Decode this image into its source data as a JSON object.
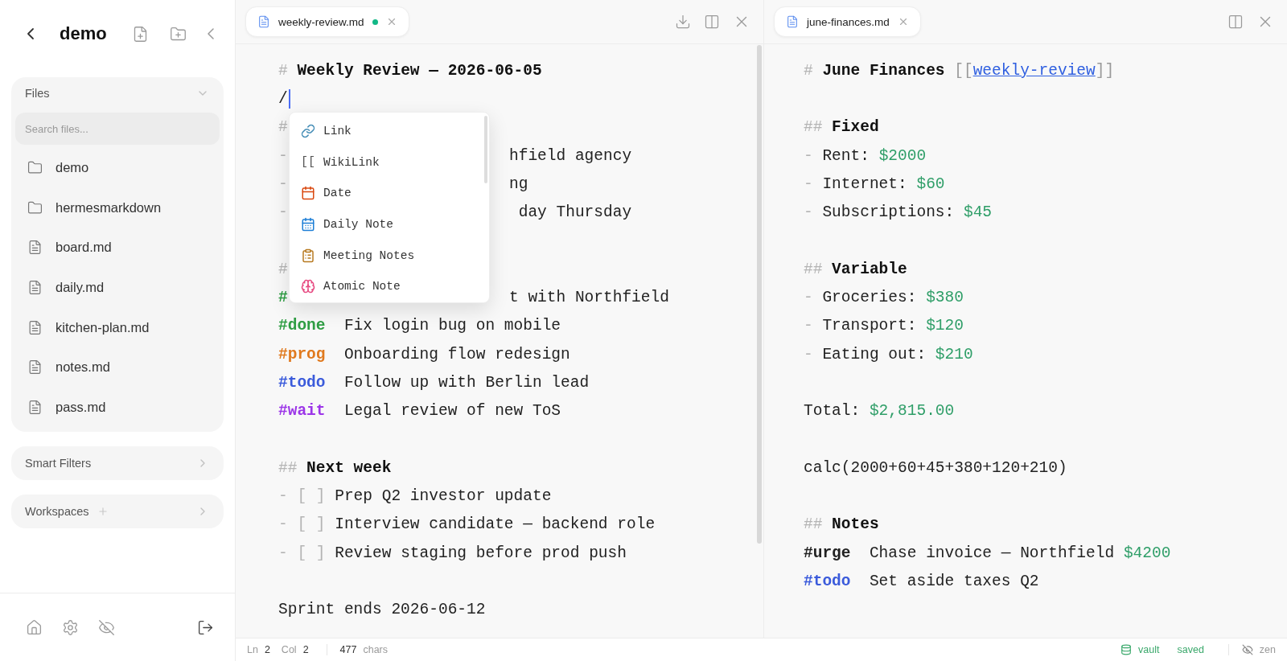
{
  "sidebar": {
    "title": "demo",
    "files": {
      "title": "Files",
      "expanded": true,
      "search": {
        "placeholder": "Search files..."
      },
      "items": [
        {
          "kind": "folder",
          "name": "demo"
        },
        {
          "kind": "folder",
          "name": "hermesmarkdown"
        },
        {
          "kind": "file",
          "name": "board.md"
        },
        {
          "kind": "file",
          "name": "daily.md"
        },
        {
          "kind": "file",
          "name": "kitchen-plan.md"
        },
        {
          "kind": "file",
          "name": "notes.md"
        },
        {
          "kind": "file",
          "name": "pass.md"
        }
      ]
    },
    "sections": [
      {
        "title": "Smart Filters",
        "addable": false
      },
      {
        "title": "Workspaces",
        "addable": true
      }
    ]
  },
  "panes": [
    {
      "tab": {
        "label": "weekly-review.md",
        "modified": true
      },
      "actions": [
        {
          "kind": "download"
        },
        {
          "kind": "split"
        },
        {
          "kind": "close"
        }
      ],
      "scrollbar": true,
      "lines": [
        {
          "kind": "text",
          "segments": [
            {
              "kind": "mark",
              "text": "#"
            },
            {
              "kind": "heading",
              "text": "Weekly Review — 2026-06-05"
            }
          ]
        },
        {
          "kind": "text",
          "cursor": true,
          "segments": [
            {
              "kind": "text",
              "text": "/"
            }
          ]
        },
        {
          "kind": "split",
          "left": {
            "kind": "mark",
            "text": "#"
          }
        },
        {
          "kind": "split",
          "left": {
            "kind": "mark",
            "text": "-"
          },
          "right": "hfield agency"
        },
        {
          "kind": "split",
          "left": {
            "kind": "mark",
            "text": "-"
          },
          "right": "ng"
        },
        {
          "kind": "split",
          "left": {
            "kind": "mark",
            "text": "-"
          },
          "right": " day Thursday"
        },
        {
          "kind": "blank"
        },
        {
          "kind": "split",
          "left": {
            "kind": "mark",
            "text": "#"
          }
        },
        {
          "kind": "split",
          "left": {
            "kind": "tag",
            "text": "#",
            "color": "#2f9e44"
          },
          "right": "t with Northfield"
        },
        {
          "kind": "text",
          "segments": [
            {
              "kind": "tag",
              "text": "#done",
              "color": "#2f9e44"
            },
            {
              "kind": "text",
              "text": "Fix login bug on mobile"
            }
          ]
        },
        {
          "kind": "text",
          "segments": [
            {
              "kind": "tag",
              "text": "#prog",
              "color": "#e07a1f"
            },
            {
              "kind": "text",
              "text": "Onboarding flow redesign"
            }
          ]
        },
        {
          "kind": "text",
          "segments": [
            {
              "kind": "tag",
              "text": "#todo",
              "color": "#3b5bdb"
            },
            {
              "kind": "text",
              "text": "Follow up with Berlin lead"
            }
          ]
        },
        {
          "kind": "text",
          "segments": [
            {
              "kind": "tag",
              "text": "#wait",
              "color": "#9c36e8"
            },
            {
              "kind": "text",
              "text": "Legal review of new ToS"
            }
          ]
        },
        {
          "kind": "blank"
        },
        {
          "kind": "text",
          "segments": [
            {
              "kind": "mark",
              "text": "##"
            },
            {
              "kind": "heading",
              "text": "Next week"
            }
          ]
        },
        {
          "kind": "text",
          "segments": [
            {
              "kind": "mark",
              "text": "-"
            },
            {
              "kind": "mark",
              "text": "[ ]"
            },
            {
              "kind": "text",
              "text": "Prep Q2 investor update"
            }
          ]
        },
        {
          "kind": "text",
          "segments": [
            {
              "kind": "mark",
              "text": "-"
            },
            {
              "kind": "mark",
              "text": "[ ]"
            },
            {
              "kind": "text",
              "text": "Interview candidate — backend role"
            }
          ]
        },
        {
          "kind": "text",
          "segments": [
            {
              "kind": "mark",
              "text": "-"
            },
            {
              "kind": "mark",
              "text": "[ ]"
            },
            {
              "kind": "text",
              "text": "Review staging before prod push"
            }
          ]
        },
        {
          "kind": "blank"
        },
        {
          "kind": "text",
          "segments": [
            {
              "kind": "text",
              "text": "Sprint ends 2026-06-12"
            }
          ]
        }
      ],
      "menu": [
        {
          "kind": "link",
          "label": "Link"
        },
        {
          "kind": "glyph",
          "glyph": "[[",
          "label": "WikiLink"
        },
        {
          "kind": "date",
          "label": "Date"
        },
        {
          "kind": "daily",
          "label": "Daily Note"
        },
        {
          "kind": "meeting",
          "label": "Meeting Notes"
        },
        {
          "kind": "atomic",
          "label": "Atomic Note"
        }
      ]
    },
    {
      "tab": {
        "label": "june-finances.md",
        "modified": false
      },
      "actions": [
        {
          "kind": "split"
        },
        {
          "kind": "close"
        }
      ],
      "lines": [
        {
          "kind": "text",
          "segments": [
            {
              "kind": "mark",
              "text": "#"
            },
            {
              "kind": "heading",
              "text": "June Finances"
            },
            {
              "kind": "bracket",
              "text": "[["
            },
            {
              "kind": "link",
              "text": "weekly-review"
            },
            {
              "kind": "bracket",
              "text": "]]"
            }
          ]
        },
        {
          "kind": "blank"
        },
        {
          "kind": "text",
          "segments": [
            {
              "kind": "mark",
              "text": "##"
            },
            {
              "kind": "heading",
              "text": "Fixed"
            }
          ]
        },
        {
          "kind": "text",
          "segments": [
            {
              "kind": "mark",
              "text": "-"
            },
            {
              "kind": "text",
              "text": "Rent:"
            },
            {
              "kind": "money",
              "text": "$2000"
            }
          ]
        },
        {
          "kind": "text",
          "segments": [
            {
              "kind": "mark",
              "text": "-"
            },
            {
              "kind": "text",
              "text": "Internet:"
            },
            {
              "kind": "money",
              "text": "$60"
            }
          ]
        },
        {
          "kind": "text",
          "segments": [
            {
              "kind": "mark",
              "text": "-"
            },
            {
              "kind": "text",
              "text": "Subscriptions:"
            },
            {
              "kind": "money",
              "text": "$45"
            }
          ]
        },
        {
          "kind": "blank"
        },
        {
          "kind": "text",
          "segments": [
            {
              "kind": "mark",
              "text": "##"
            },
            {
              "kind": "heading",
              "text": "Variable"
            }
          ]
        },
        {
          "kind": "text",
          "segments": [
            {
              "kind": "mark",
              "text": "-"
            },
            {
              "kind": "text",
              "text": "Groceries:"
            },
            {
              "kind": "money",
              "text": "$380"
            }
          ]
        },
        {
          "kind": "text",
          "segments": [
            {
              "kind": "mark",
              "text": "-"
            },
            {
              "kind": "text",
              "text": "Transport:"
            },
            {
              "kind": "money",
              "text": "$120"
            }
          ]
        },
        {
          "kind": "text",
          "segments": [
            {
              "kind": "mark",
              "text": "-"
            },
            {
              "kind": "text",
              "text": "Eating out:"
            },
            {
              "kind": "money",
              "text": "$210"
            }
          ]
        },
        {
          "kind": "blank"
        },
        {
          "kind": "text",
          "segments": [
            {
              "kind": "text",
              "text": "Total:"
            },
            {
              "kind": "money",
              "text": "$2,815.00"
            }
          ]
        },
        {
          "kind": "blank"
        },
        {
          "kind": "text",
          "segments": [
            {
              "kind": "text",
              "text": "calc(2000+60+45+380+120+210)"
            }
          ]
        },
        {
          "kind": "blank"
        },
        {
          "kind": "text",
          "segments": [
            {
              "kind": "mark",
              "text": "##"
            },
            {
              "kind": "heading",
              "text": "Notes"
            }
          ]
        },
        {
          "kind": "text",
          "segments": [
            {
              "kind": "tag",
              "text": "#urge",
              "color": "#222222"
            },
            {
              "kind": "text",
              "text": "Chase invoice — Northfield"
            },
            {
              "kind": "money",
              "text": "$4200"
            }
          ]
        },
        {
          "kind": "text",
          "segments": [
            {
              "kind": "tag",
              "text": "#todo",
              "color": "#3b5bdb"
            },
            {
              "kind": "text",
              "text": "Set aside taxes Q2"
            }
          ]
        }
      ]
    }
  ],
  "status_bar": {
    "line_label": "Ln",
    "line": "2",
    "col_label": "Col",
    "col": "2",
    "count": "477",
    "count_label": "chars",
    "vault": "vault",
    "save_state": "saved",
    "zen": "zen"
  }
}
